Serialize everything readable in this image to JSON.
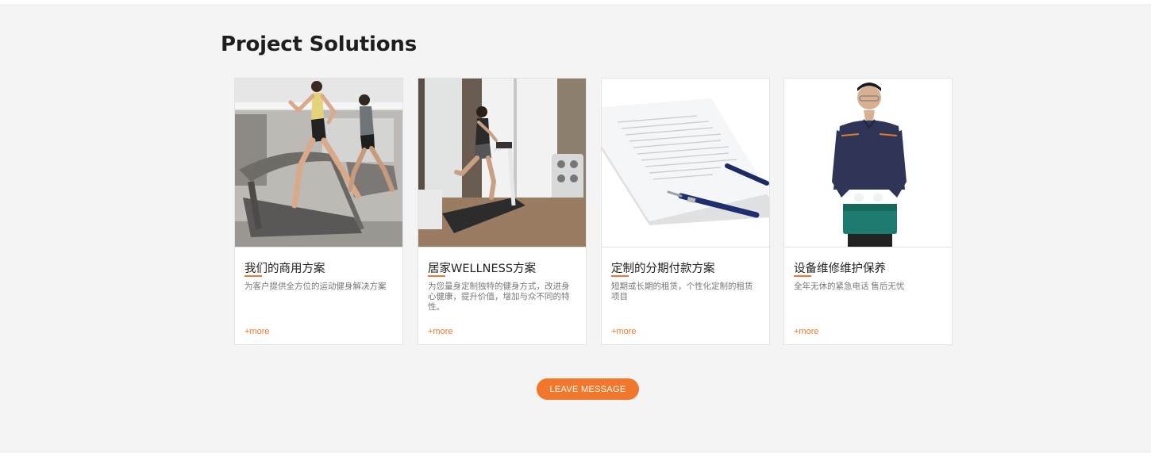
{
  "section": {
    "title": "Project Solutions"
  },
  "cards": [
    {
      "title": "我们的商用方案",
      "desc": "为客户提供全方位的运动健身解决方案",
      "more": "+more"
    },
    {
      "title": "居家WELLNESS方案",
      "desc": "为您量身定制独特的健身方式，改进身心健康，提升价值，增加与众不同的特性。",
      "more": "+more"
    },
    {
      "title": "定制的分期付款方案",
      "desc": "短期或长期的租赁，个性化定制的租赁项目",
      "more": "+more"
    },
    {
      "title": "设备维修维护保养",
      "desc": "全年无休的紧急电话 售后无忧",
      "more": "+more"
    }
  ],
  "cta": {
    "label": "LEAVE MESSAGE"
  },
  "colors": {
    "accent": "#f0772b",
    "background": "#f4f4f4",
    "card": "#ffffff"
  }
}
